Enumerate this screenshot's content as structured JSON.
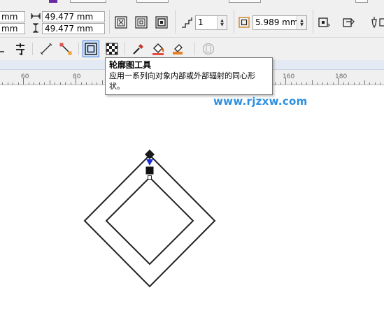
{
  "property_bar": {
    "x_value": "mm",
    "y_value": "mm",
    "width_value": "49.477 mm",
    "height_value": "49.477 mm",
    "steps_value": "1",
    "offset_value": "5.989 mm"
  },
  "toolbox": {
    "tooltip": {
      "title": "轮廓图工具",
      "description": "应用一系列向对象内部或外部辐射的同心形状。"
    }
  },
  "ruler": {
    "labels": [
      "60",
      "80",
      "160",
      "180"
    ]
  },
  "watermark": "www.rjzxw.com",
  "colors": {
    "accent": "#2e8fe0",
    "selection_blue": "#1a2bd9",
    "shape_stroke": "#222222"
  }
}
